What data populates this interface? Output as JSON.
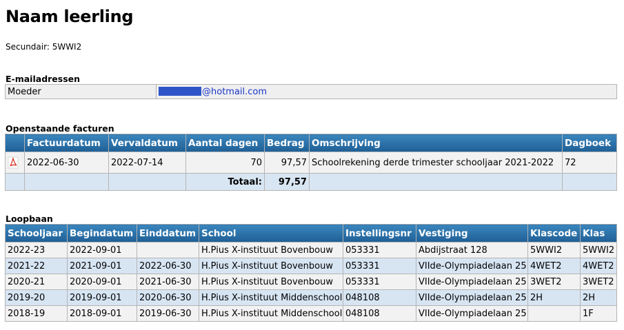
{
  "page": {
    "title": "Naam leerling",
    "secondary": "Secundair: 5WWI2"
  },
  "email": {
    "heading": "E-mailadressen",
    "rows": [
      {
        "label": "Moeder",
        "address_domain": "@hotmail.com",
        "redaction_color": "#2d54c9"
      }
    ]
  },
  "invoices": {
    "heading": "Openstaande facturen",
    "columns": [
      "",
      "Factuurdatum",
      "Vervaldatum",
      "Aantal dagen",
      "Bedrag",
      "Omschrijving",
      "Dagboek"
    ],
    "rows": [
      {
        "icon": "pdf-icon",
        "factuurdatum": "2022-06-30",
        "vervaldatum": "2022-07-14",
        "aantal_dagen": "70",
        "bedrag": "97,57",
        "omschrijving": "Schoolrekening derde trimester schooljaar 2021-2022",
        "dagboek": "72"
      }
    ],
    "total_label": "Totaal:",
    "total_value": "97,57"
  },
  "career": {
    "heading": "Loopbaan",
    "columns": [
      "Schooljaar",
      "Begindatum",
      "Einddatum",
      "School",
      "Instellingsnr",
      "Vestiging",
      "Klascode",
      "Klas"
    ],
    "rows": [
      [
        "2022-23",
        "2022-09-01",
        "",
        "H.Pius X-instituut Bovenbouw",
        "053331",
        "Abdijstraat 128",
        "5WWI2",
        "5WWI2"
      ],
      [
        "2021-22",
        "2021-09-01",
        "2022-06-30",
        "H.Pius X-instituut Bovenbouw",
        "053331",
        "VIIde-Olympiadelaan 25",
        "4WET2",
        "4WET2"
      ],
      [
        "2020-21",
        "2020-09-01",
        "2021-06-30",
        "H.Pius X-instituut Bovenbouw",
        "053331",
        "VIIde-Olympiadelaan 25",
        "3WET2",
        "3WET2"
      ],
      [
        "2019-20",
        "2019-09-01",
        "2020-06-30",
        "H.Pius X-instituut Middenschool",
        "048108",
        "VIIde-Olympiadelaan 25",
        "2H",
        "2H"
      ],
      [
        "2018-19",
        "2018-09-01",
        "2019-06-30",
        "H.Pius X-instituut Middenschool",
        "048108",
        "VIIde-Olympiadelaan 25",
        "",
        "1F"
      ]
    ]
  },
  "colors": {
    "header_blue": "#2a70a8",
    "row_alt_blue": "#d7e5f3",
    "row_grey": "#f2f2f2",
    "link_blue": "#1a36c8"
  }
}
